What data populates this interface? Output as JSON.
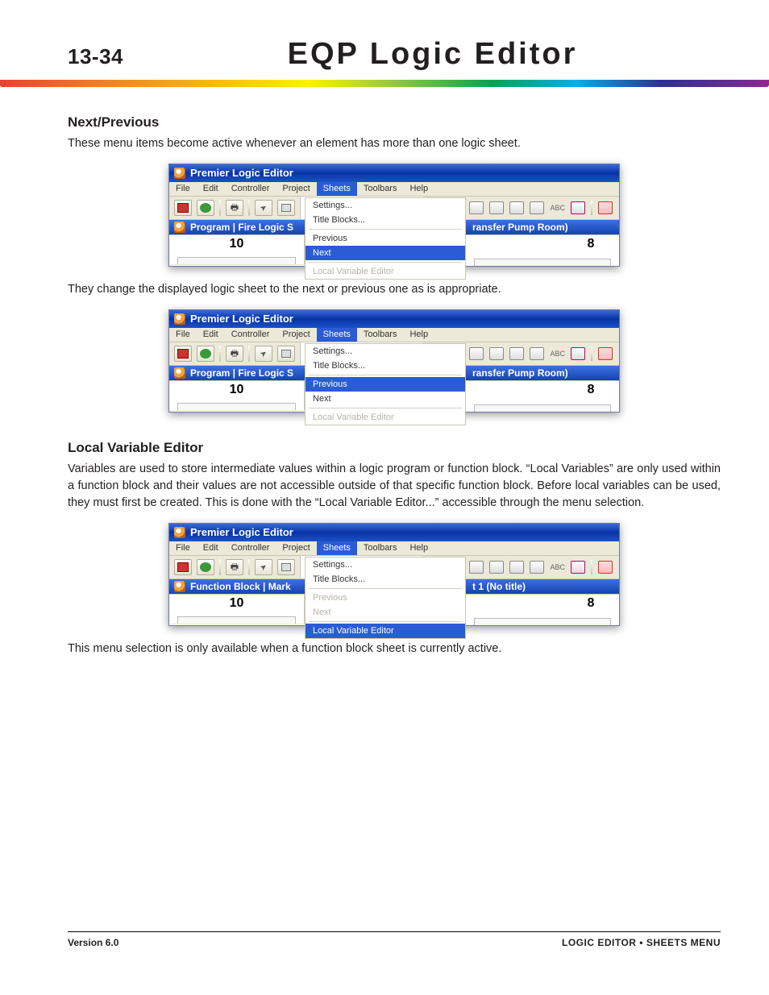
{
  "header": {
    "page_number": "13-34",
    "title": "EQP Logic Editor"
  },
  "sections": {
    "next_prev": {
      "heading": "Next/Previous",
      "para1": "These menu items become active whenever an element has more than one logic sheet.",
      "para2": "They change the displayed logic sheet to the next or previous one as is appropriate."
    },
    "local_var": {
      "heading": "Local Variable Editor",
      "para1": "Variables are used to store intermediate values within a logic program or function block.  “Local Variables” are only used within a function block and their values are not accessible outside of that specific function block.  Before local variables can be used, they must first be created.  This is done with the “Local Variable Editor...” accessible through the menu selection.",
      "para2": "This menu selection is only available when a function block sheet is currently active."
    }
  },
  "menus": {
    "main": [
      "File",
      "Edit",
      "Controller",
      "Project",
      "Sheets",
      "Toolbars",
      "Help"
    ],
    "sheets": {
      "settings": "Settings...",
      "title_blocks": "Title Blocks...",
      "previous": "Previous",
      "next": "Next",
      "lve": "Local Variable Editor"
    }
  },
  "window": {
    "title": "Premier Logic Editor",
    "doctab_fire": "Program  |  Fire Logic S",
    "doctab_right_fire": "ransfer Pump Room)",
    "doctab_fb": "Function Block  |  Mark",
    "doctab_right_fb": "t 1 (No title)",
    "left_num": "10",
    "right_num": "8"
  },
  "toolbar_abc": "ABC",
  "footer": {
    "left": "Version 6.0",
    "right": "LOGIC EDITOR • SHEETS MENU"
  }
}
